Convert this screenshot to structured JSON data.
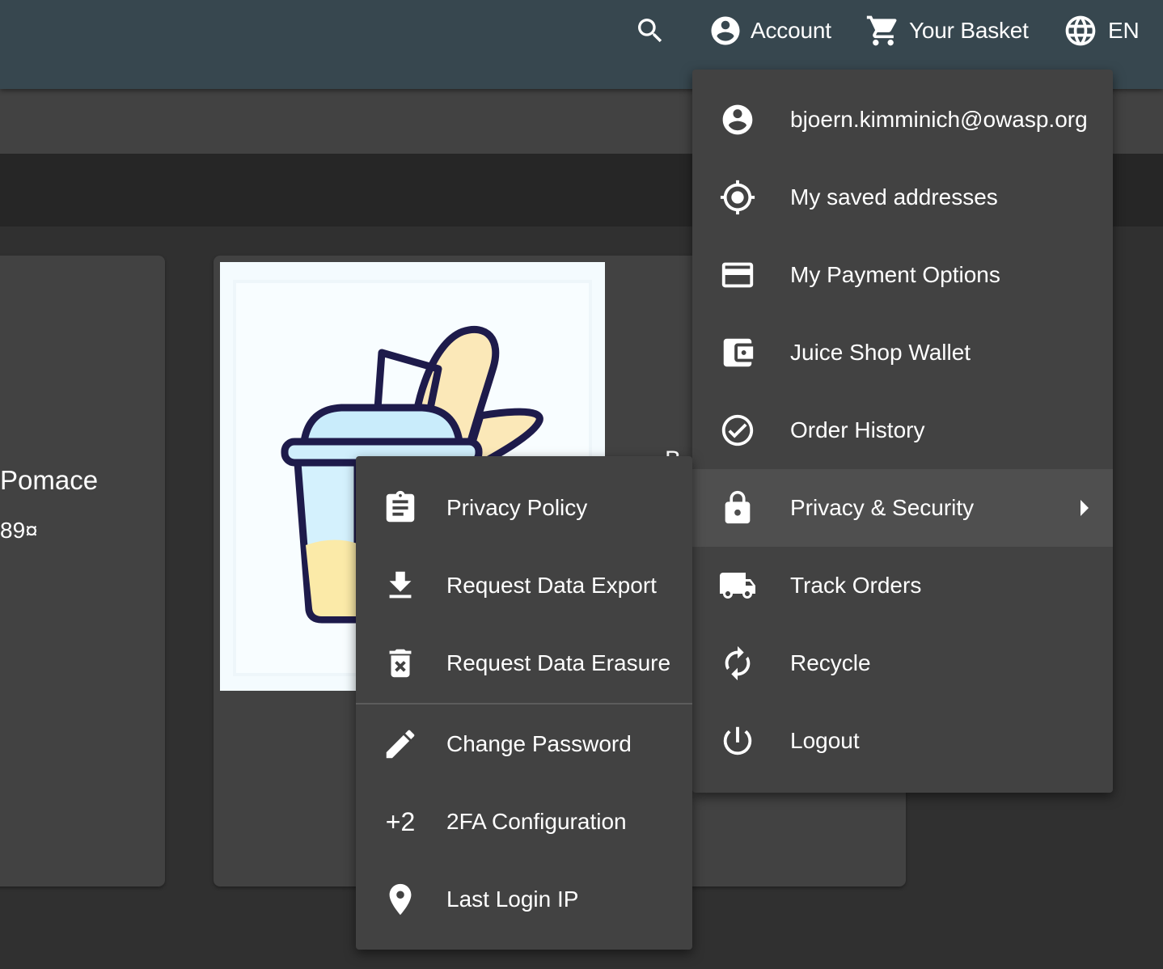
{
  "header": {
    "search_icon": "search-icon",
    "account_label": "Account",
    "basket_label": "Your Basket",
    "language_label": "EN"
  },
  "product": {
    "name": "Pomace",
    "price": "89¤",
    "peek_text": "B"
  },
  "account_menu": {
    "items": [
      {
        "label": "bjoern.kimminich@owasp.org",
        "icon": "account-circle-icon"
      },
      {
        "label": "My saved addresses",
        "icon": "location-target-icon"
      },
      {
        "label": "My Payment Options",
        "icon": "credit-card-icon"
      },
      {
        "label": "Juice Shop Wallet",
        "icon": "wallet-icon"
      },
      {
        "label": "Order History",
        "icon": "check-circle-icon"
      },
      {
        "label": "Privacy & Security",
        "icon": "lock-icon",
        "has_submenu": true,
        "active": true
      },
      {
        "label": "Track Orders",
        "icon": "truck-icon"
      },
      {
        "label": "Recycle",
        "icon": "recycle-icon"
      },
      {
        "label": "Logout",
        "icon": "power-icon"
      }
    ]
  },
  "privacy_menu": {
    "items": [
      {
        "label": "Privacy Policy",
        "icon": "clipboard-icon"
      },
      {
        "label": "Request Data Export",
        "icon": "download-icon"
      },
      {
        "label": "Request Data Erasure",
        "icon": "delete-forever-icon"
      },
      {
        "label": "Change Password",
        "icon": "pencil-icon"
      },
      {
        "label": "2FA Configuration",
        "icon": "plus-two-icon",
        "icon_text": "+2"
      },
      {
        "label": "Last Login IP",
        "icon": "location-pin-icon"
      }
    ]
  },
  "colors": {
    "toolbar": "#37474f",
    "background": "#303030",
    "menu": "#424242",
    "menu_active": "#4f4f4f",
    "card": "#424242"
  }
}
